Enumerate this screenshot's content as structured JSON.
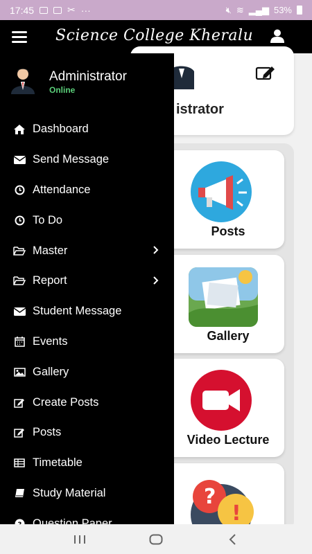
{
  "status": {
    "time": "17:45",
    "dots": "···",
    "battery": "53%"
  },
  "appbar": {
    "title": "Science College Kheralu"
  },
  "profile": {
    "name_partial": "istrator"
  },
  "tiles": [
    {
      "label": "Posts",
      "icon": "megaphone-icon"
    },
    {
      "label": "Gallery",
      "icon": "gallery-icon"
    },
    {
      "label": "Video Lecture",
      "icon": "video-icon"
    },
    {
      "label": "",
      "icon": "question-icon"
    }
  ],
  "drawer": {
    "user": {
      "name": "Administrator",
      "status": "Online"
    },
    "items": [
      {
        "label": "Dashboard",
        "icon": "home-icon"
      },
      {
        "label": "Send Message",
        "icon": "envelope-icon"
      },
      {
        "label": "Attendance",
        "icon": "clock-icon"
      },
      {
        "label": "To Do",
        "icon": "clock-icon"
      },
      {
        "label": "Master",
        "icon": "folder-open-icon",
        "has_chevron": true
      },
      {
        "label": "Report",
        "icon": "folder-open-icon",
        "has_chevron": true
      },
      {
        "label": "Student Message",
        "icon": "envelope-icon"
      },
      {
        "label": "Events",
        "icon": "calendar-icon"
      },
      {
        "label": "Gallery",
        "icon": "image-icon"
      },
      {
        "label": "Create Posts",
        "icon": "edit-icon"
      },
      {
        "label": "Posts",
        "icon": "edit-icon"
      },
      {
        "label": "Timetable",
        "icon": "table-icon"
      },
      {
        "label": "Study Material",
        "icon": "book-icon"
      },
      {
        "label": "Question Paper",
        "icon": "question-circle-icon"
      }
    ]
  },
  "colors": {
    "status_bar": "#c9a9ca",
    "app_bar": "#000000",
    "online": "#5bd07a",
    "video_red": "#d5102f",
    "megaphone_blue": "#2ea8de"
  }
}
